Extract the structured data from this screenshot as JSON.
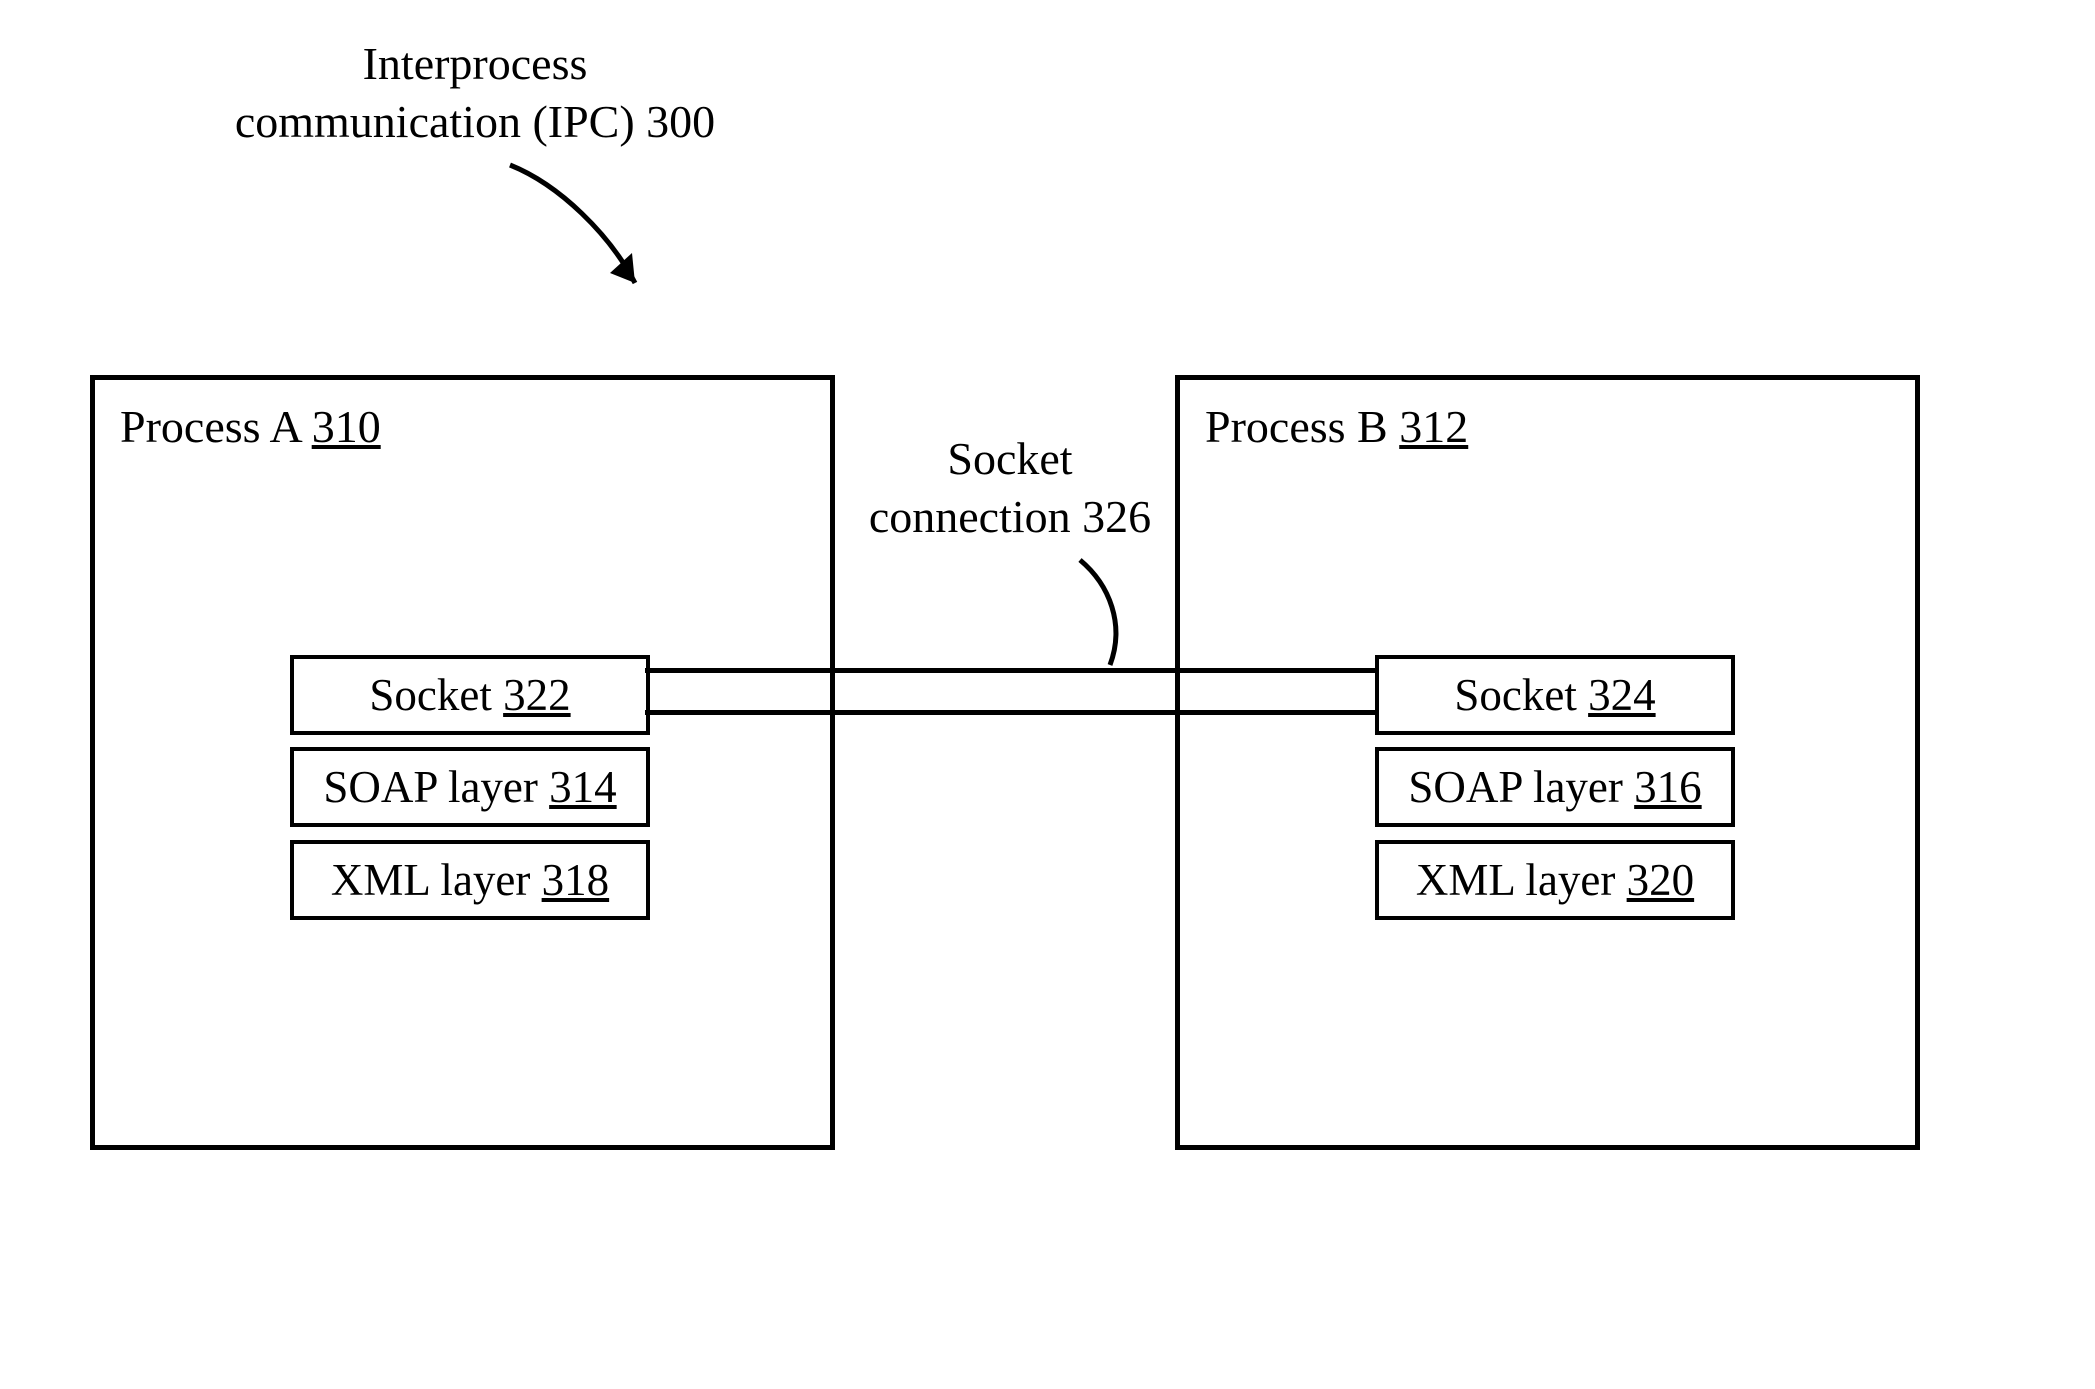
{
  "title": {
    "line1": "Interprocess",
    "line2": "communication (IPC) 300"
  },
  "processA": {
    "label_prefix": "Process A ",
    "ref": "310",
    "socket_prefix": "Socket ",
    "socket_ref": "322",
    "soap_prefix": "SOAP layer ",
    "soap_ref": "314",
    "xml_prefix": "XML layer ",
    "xml_ref": "318"
  },
  "processB": {
    "label_prefix": "Process B ",
    "ref": "312",
    "socket_prefix": "Socket ",
    "socket_ref": "324",
    "soap_prefix": "SOAP layer ",
    "soap_ref": "316",
    "xml_prefix": "XML layer ",
    "xml_ref": "320"
  },
  "connection": {
    "line1": "Socket",
    "line2": "connection 326"
  }
}
